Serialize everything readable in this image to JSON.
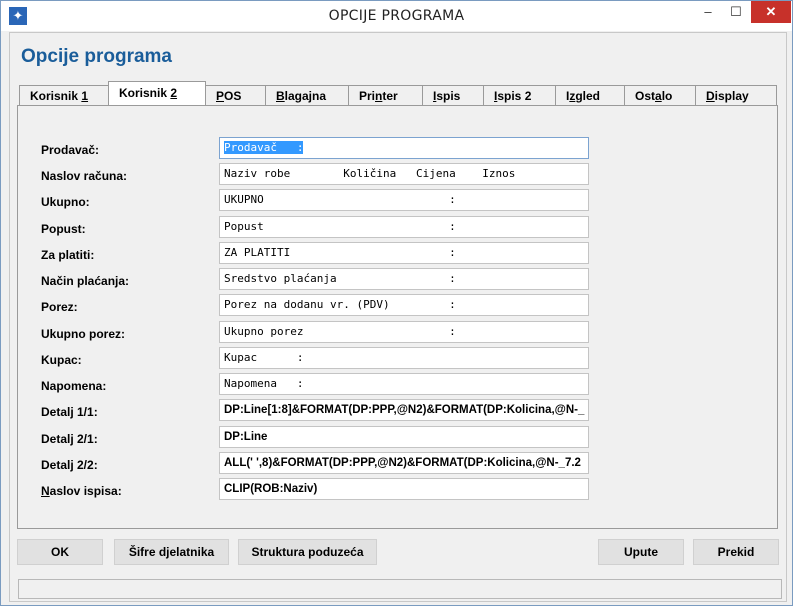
{
  "window": {
    "title": "OPCIJE PROGRAMA",
    "icon": "app-star-icon",
    "controls": {
      "minimize": "–",
      "maximize": "☐",
      "close": "✕"
    }
  },
  "heading": "Opcije programa",
  "tabs": [
    {
      "label_pre": "Korisnik ",
      "label_u": "1",
      "label_post": ""
    },
    {
      "label_pre": "Korisnik ",
      "label_u": "2",
      "label_post": ""
    },
    {
      "label_pre": "",
      "label_u": "P",
      "label_post": "OS"
    },
    {
      "label_pre": "",
      "label_u": "B",
      "label_post": "lagajna"
    },
    {
      "label_pre": "Pri",
      "label_u": "n",
      "label_post": "ter"
    },
    {
      "label_pre": "",
      "label_u": "I",
      "label_post": "spis"
    },
    {
      "label_pre": "",
      "label_u": "I",
      "label_post": "spis 2"
    },
    {
      "label_pre": "I",
      "label_u": "z",
      "label_post": "gled"
    },
    {
      "label_pre": "Ost",
      "label_u": "a",
      "label_post": "lo"
    },
    {
      "label_pre": "",
      "label_u": "D",
      "label_post": "isplay"
    }
  ],
  "active_tab": "Korisnik 2",
  "fields": [
    {
      "label": "Prodavač:",
      "value": "Prodavač   :"
    },
    {
      "label": "Naslov računa:",
      "value": "Naziv robe        Količina   Cijena    Iznos"
    },
    {
      "label": "Ukupno:",
      "value": "UKUPNO                            :"
    },
    {
      "label": "Popust:",
      "value": "Popust                            :"
    },
    {
      "label": "Za platiti:",
      "value": "ZA PLATITI                        :"
    },
    {
      "label": "Način plaćanja:",
      "value": "Sredstvo plaćanja                 :"
    },
    {
      "label": "Porez:",
      "value": "Porez na dodanu vr. (PDV)         :"
    },
    {
      "label": "Ukupno porez:",
      "value": "Ukupno porez                      :"
    },
    {
      "label": "Kupac:",
      "value": "Kupac      :"
    },
    {
      "label": "Napomena:",
      "value": "Napomena   :"
    },
    {
      "label": "Detalj 1/1:",
      "value": "DP:Line[1:8]&FORMAT(DP:PPP,@N2)&FORMAT(DP:Kolicina,@N-_"
    },
    {
      "label": "Detalj 2/1:",
      "value": "DP:Line"
    },
    {
      "label": "Detalj 2/2:",
      "value": "ALL(' ',8)&FORMAT(DP:PPP,@N2)&FORMAT(DP:Kolicina,@N-_7.2"
    },
    {
      "label_u": "N",
      "label_post": "aslov ispisa:",
      "value": "CLIP(ROB:Naziv)"
    }
  ],
  "buttons": {
    "ok": "OK",
    "sifre": "Šifre djelatnika",
    "struktura": "Struktura poduzeća",
    "upute": "Upute",
    "prekid": "Prekid"
  }
}
